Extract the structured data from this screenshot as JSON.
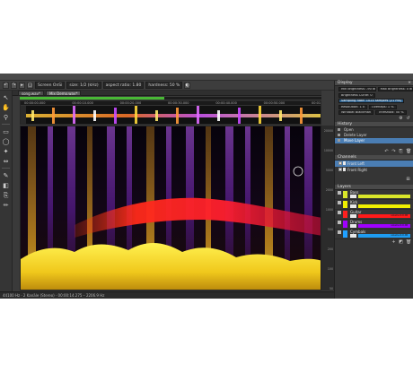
{
  "toolbar": {
    "mode_label": "Screen OnSi",
    "size_label": "size: 1/2 (kHz)",
    "aspect_label": "aspect ratio: 1.80",
    "hardness_label": "hardness: 50 %",
    "icons": [
      "undo-icon",
      "redo-icon",
      "pointer-icon",
      "select-icon",
      "lasso-icon",
      "layer-icon"
    ]
  },
  "tabs": [
    {
      "label": "song.wav*",
      "active": false
    },
    {
      "label": "Mix Demo.wav*",
      "active": true
    }
  ],
  "playback": {
    "progress": 0.48
  },
  "timeline": {
    "ticks": [
      "00:00:00.000",
      "00:00:10.000",
      "00:00:20.000",
      "00:00:30.000",
      "00:00:40.000",
      "00:00:50.000",
      "00:01:00.000"
    ]
  },
  "frequency_scale": [
    "20000",
    "10000",
    "5000",
    "2000",
    "1000",
    "500",
    "200",
    "100",
    "50"
  ],
  "status": {
    "text": "44100 Hz · 2 Kanäle (Stereo) · 00:00:14.275 – 2206.9 Hz"
  },
  "display_panel": {
    "title": "Display",
    "rows": [
      {
        "label": "Min brightness: -90 dB",
        "value": "Max brightness: 0 dB"
      },
      {
        "label": "Brightness Curve: 0",
        "value": ""
      },
      {
        "label": "Sampling Rate: 1024 samples (21 ms)",
        "value": "",
        "highlight": true
      },
      {
        "label": "Resolution: 1 x",
        "value": "Overlaps: 1 %"
      },
      {
        "label": "Window: Blackman",
        "value": "Threshold: 50 %"
      }
    ]
  },
  "history_panel": {
    "title": "History",
    "items": [
      {
        "label": "Open",
        "selected": false
      },
      {
        "label": "Delete Layer",
        "selected": false
      },
      {
        "label": "Move Layer",
        "selected": true
      }
    ]
  },
  "channels_panel": {
    "title": "Channels",
    "items": [
      {
        "label": "Front Left",
        "color": "#e8e8e8",
        "selected": true
      },
      {
        "label": "Front Right",
        "color": "#e8e8e8",
        "selected": false
      }
    ]
  },
  "layers_panel": {
    "title": "Layers",
    "items": [
      {
        "name": "Bass",
        "swatch": "#d9e62a",
        "bar": "#d9e62a",
        "bar_label": ""
      },
      {
        "name": "Kick",
        "swatch": "#f0f000",
        "bar": "#f0f000",
        "bar_label": ""
      },
      {
        "name": "Guitar",
        "swatch": "#ff2020",
        "bar": "#ff1a1a",
        "bar_label": "volume 0.0 dB"
      },
      {
        "name": "Drums",
        "swatch": "#a000ff",
        "bar": "#a000ff",
        "bar_label": "volume 0.0 dB"
      },
      {
        "name": "Cymbals",
        "swatch": "#20a0ff",
        "bar": "#1e9cf0",
        "bar_label": "volume 0.0 dB"
      }
    ]
  },
  "colors": {
    "accent": "#4a7db3",
    "progress": "#48b835",
    "background": "#3a3a3a"
  }
}
